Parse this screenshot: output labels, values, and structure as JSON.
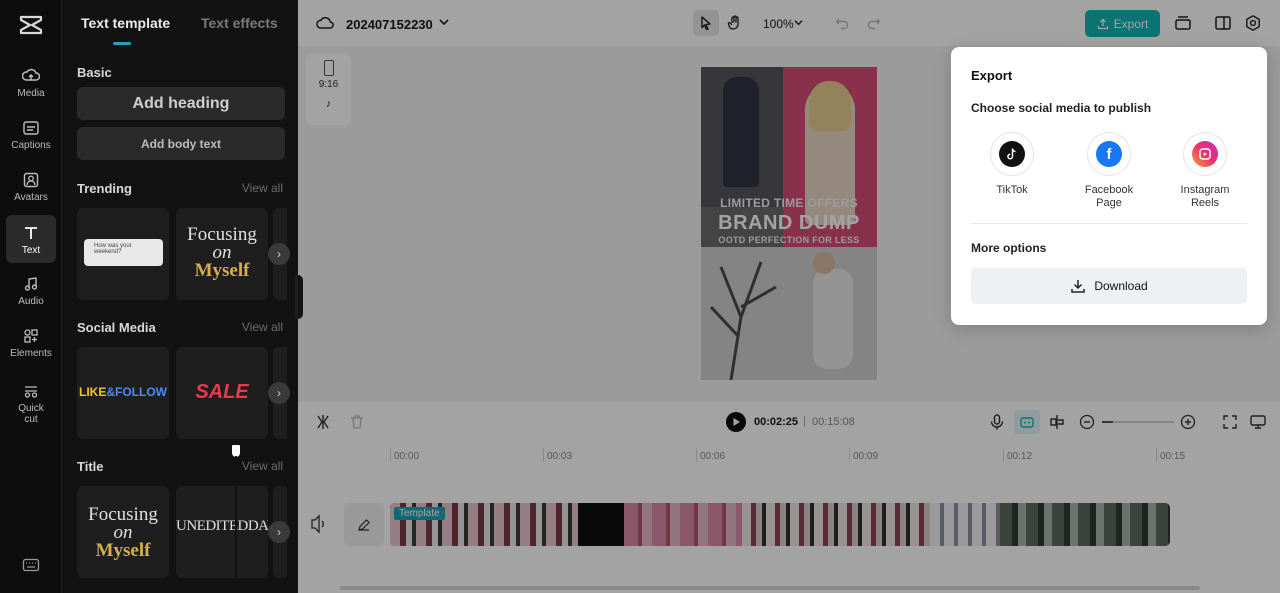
{
  "rail": {
    "items": [
      {
        "label": "Media",
        "icon": "media-cloud-icon"
      },
      {
        "label": "Captions",
        "icon": "captions-icon"
      },
      {
        "label": "Avatars",
        "icon": "avatar-icon"
      },
      {
        "label": "Text",
        "icon": "text-t-icon"
      },
      {
        "label": "Audio",
        "icon": "music-note-icon"
      },
      {
        "label": "Elements",
        "icon": "elements-grid-icon"
      },
      {
        "label": "Quick cut",
        "icon": "scissors-icon"
      }
    ],
    "active": "Text"
  },
  "panel": {
    "tabs": [
      "Text template",
      "Text effects"
    ],
    "basic": {
      "title": "Basic",
      "add_heading": "Add heading",
      "add_body": "Add body text"
    },
    "trending": {
      "title": "Trending",
      "view_all": "View all",
      "card2_line1": "Focusing",
      "card2_line2": "on",
      "card2_line3": "Myself",
      "card1_small": "How was your weekend?"
    },
    "social": {
      "title": "Social Media",
      "view_all": "View all",
      "card1_a": "LIKE",
      "card1_b": "&FOLLOW",
      "card2_big": "SALE"
    },
    "title_sec": {
      "title": "Title",
      "view_all": "View all",
      "card1_line1": "Focusing",
      "card1_line2": "on",
      "card1_line3": "Myself",
      "card2_text": "UNEDITEDDAY"
    }
  },
  "topbar": {
    "project": "202407152230",
    "zoom": "100%",
    "export": "Export"
  },
  "canvas": {
    "ratio": "9:16",
    "video_text1": "LIMITED TIME OFFERS",
    "video_text2": "BRAND DUMP",
    "video_text3": "OOTD PERFECTION FOR LESS"
  },
  "timeline": {
    "current": "00:02:25",
    "separator": "|",
    "total": "00:15:08",
    "ticks": [
      "00:00",
      "00:03",
      "00:06",
      "00:09",
      "00:12",
      "00:15"
    ],
    "template_tag": "Template",
    "zoom_level": 0.15,
    "playhead_time": "00:02:25"
  },
  "popup": {
    "title": "Export",
    "subtitle": "Choose social media to publish",
    "options": [
      {
        "label": "TikTok"
      },
      {
        "label": "Facebook Page"
      },
      {
        "label": "Instagram Reels"
      }
    ],
    "more": "More options",
    "download": "Download"
  },
  "colors": {
    "accent": "#12b5b2",
    "facebook": "#1877f2",
    "instagram_start": "#f9a13a",
    "instagram_end": "#c12ec9"
  }
}
